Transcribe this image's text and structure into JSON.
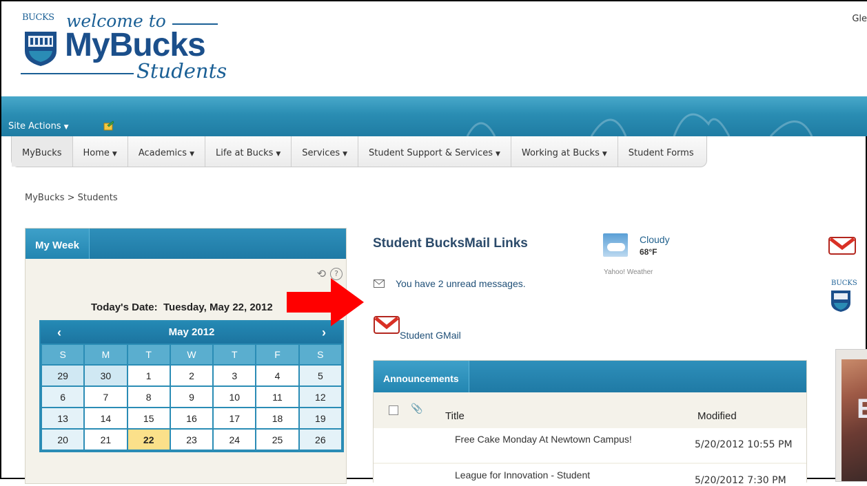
{
  "header": {
    "logo_small": "BUCKS",
    "logo_welcome": "welcome to",
    "logo_main": "MyBucks",
    "logo_sub": "Students",
    "user_name_partial": "Gle"
  },
  "site_actions": {
    "label": "Site Actions",
    "icon": "edit-page-icon"
  },
  "nav": {
    "items": [
      {
        "label": "MyBucks",
        "dropdown": false
      },
      {
        "label": "Home",
        "dropdown": true
      },
      {
        "label": "Academics",
        "dropdown": true
      },
      {
        "label": "Life at Bucks",
        "dropdown": true
      },
      {
        "label": "Services",
        "dropdown": true
      },
      {
        "label": "Student Support & Services",
        "dropdown": true
      },
      {
        "label": "Working at Bucks",
        "dropdown": true
      },
      {
        "label": "Student Forms",
        "dropdown": false
      }
    ]
  },
  "breadcrumb": "MyBucks > Students",
  "my_week": {
    "title": "My Week",
    "today_label": "Today's Date:",
    "today_value": "Tuesday, May 22, 2012",
    "calendar": {
      "month": "May 2012",
      "prev": "‹",
      "next": "›",
      "weekdays": [
        "S",
        "M",
        "T",
        "W",
        "T",
        "F",
        "S"
      ],
      "weeks": [
        [
          "29",
          "30",
          "1",
          "2",
          "3",
          "4",
          "5"
        ],
        [
          "6",
          "7",
          "8",
          "9",
          "10",
          "11",
          "12"
        ],
        [
          "13",
          "14",
          "15",
          "16",
          "17",
          "18",
          "19"
        ],
        [
          "20",
          "21",
          "22",
          "23",
          "24",
          "25",
          "26"
        ]
      ],
      "today": "22",
      "other_month": [
        "29",
        "30"
      ]
    }
  },
  "mail": {
    "title": "Student BucksMail Links",
    "unread": "You have 2 unread messages.",
    "gmail_label": "Student GMail"
  },
  "weather": {
    "condition": "Cloudy",
    "temp": "68°F",
    "source": "Yahoo! Weather"
  },
  "announcements": {
    "title": "Announcements",
    "col_title": "Title",
    "col_modified": "Modified",
    "rows": [
      {
        "title": "Free Cake Monday At Newtown Campus!",
        "modified": "5/20/2012 10:55 PM"
      },
      {
        "title": "League for Innovation - Student",
        "modified": "5/20/2012 7:30 PM"
      }
    ]
  },
  "right_column": {
    "crest_text": "BUCKS",
    "photo_letter": "E"
  },
  "colors": {
    "teal": "#2a8cb5",
    "arrow": "#ff0000",
    "today": "#fbe08a",
    "brand_blue": "#1b4f8b"
  }
}
